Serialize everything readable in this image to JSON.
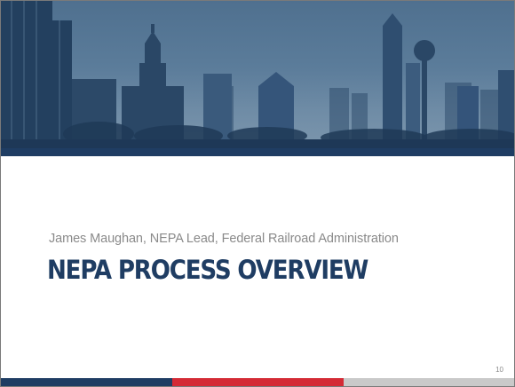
{
  "slide": {
    "subtitle": "James Maughan, NEPA Lead, Federal Railroad Administration",
    "title": "NEPA PROCESS OVERVIEW",
    "page_number": "10"
  },
  "colors": {
    "navy": "#1f3d63",
    "red": "#d42a35",
    "gray": "#c9c9c9",
    "banner_tint": "#5b7c9a"
  }
}
